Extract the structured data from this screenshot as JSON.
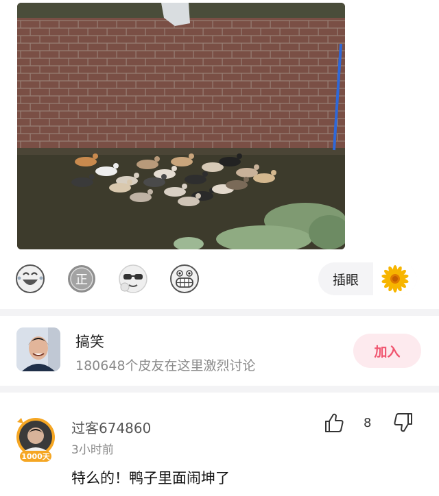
{
  "post": {
    "image": {
      "subject": "ducks-in-pond-photo"
    },
    "reactions": [
      {
        "icon": "laughing-face-icon"
      },
      {
        "icon": "zheng-badge-icon",
        "glyph": "正"
      },
      {
        "icon": "sunglasses-face-icon"
      },
      {
        "icon": "grinning-teeth-face-icon"
      }
    ],
    "insert_label": "插眼",
    "insert_icon": "sunflower-icon"
  },
  "group": {
    "name": "搞笑",
    "description": "180648个皮友在这里激烈讨论",
    "join_label": "加入"
  },
  "comment": {
    "username": "过客674860",
    "time": "3小时前",
    "avatar_badge": "1000天",
    "text": "特么的！鸭子里面闹坤了",
    "like_count": "8"
  },
  "colors": {
    "accent": "#f0556f",
    "join_bg": "#fdeaee",
    "divider": "#f3f3f5",
    "badge_gold": "#f5a623"
  }
}
